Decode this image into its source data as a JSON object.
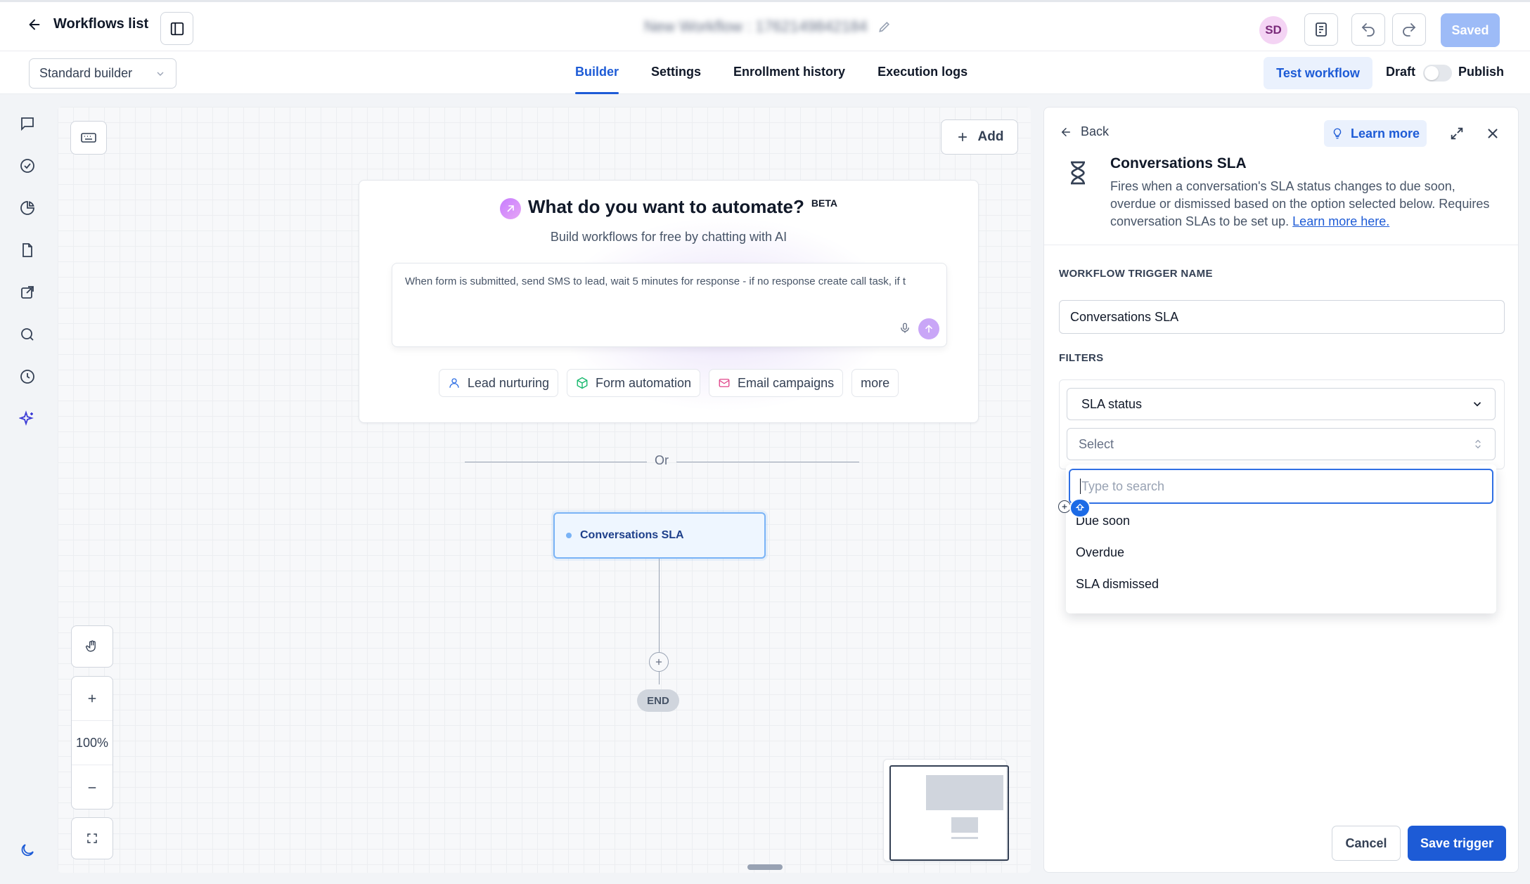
{
  "header": {
    "back_label": "Workflows list",
    "workflow_title": "New Workflow : 1762149842184",
    "avatar_initials": "SD",
    "saved_label": "Saved"
  },
  "subbar": {
    "builder_mode": "Standard builder",
    "tabs": [
      {
        "label": "Builder",
        "active": true
      },
      {
        "label": "Settings",
        "active": false
      },
      {
        "label": "Enrollment history",
        "active": false
      },
      {
        "label": "Execution logs",
        "active": false
      }
    ],
    "test_label": "Test workflow",
    "draft_label": "Draft",
    "publish_label": "Publish",
    "published": false
  },
  "leftnav": {
    "icons": [
      "chat-icon",
      "check-circle-icon",
      "pie-chart-icon",
      "document-icon",
      "external-link-icon",
      "search-icon",
      "history-icon",
      "sparkles-icon",
      "moon-icon"
    ]
  },
  "canvas": {
    "add_label": "Add",
    "ai": {
      "title": "What do you want to automate?",
      "badge": "BETA",
      "subtitle": "Build workflows for free by chatting with AI",
      "prompt_text": "When form is submitted, send SMS to lead, wait 5 minutes for response - if no response create call task, if t",
      "chips": [
        {
          "label": "Lead nurturing",
          "icon": "user-icon"
        },
        {
          "label": "Form automation",
          "icon": "cube-icon"
        },
        {
          "label": "Email campaigns",
          "icon": "mail-icon"
        },
        {
          "label": "more",
          "icon": ""
        }
      ]
    },
    "or_label": "Or",
    "trigger_node_label": "Conversations SLA",
    "end_label": "END",
    "zoom_level": "100%"
  },
  "panel": {
    "back_label": "Back",
    "learn_more_label": "Learn more",
    "trigger_title": "Conversations SLA",
    "description": "Fires when a conversation's SLA status changes to due soon, overdue or dismissed based on the option selected below. Requires conversation SLAs to be set up.",
    "description_link": "Learn more here.",
    "trigger_name_label": "WORKFLOW TRIGGER NAME",
    "trigger_name_value": "Conversations SLA",
    "filters_label": "FILTERS",
    "filter_field": "SLA status",
    "filter_value_placeholder": "Select",
    "search_placeholder": "Type to search",
    "options": [
      "Due soon",
      "Overdue",
      "SLA dismissed"
    ],
    "cancel_label": "Cancel",
    "save_label": "Save trigger"
  },
  "colors": {
    "primary": "#1d5bd6",
    "node_border": "#79b3f6",
    "saved_bg": "#9dbbf7"
  }
}
